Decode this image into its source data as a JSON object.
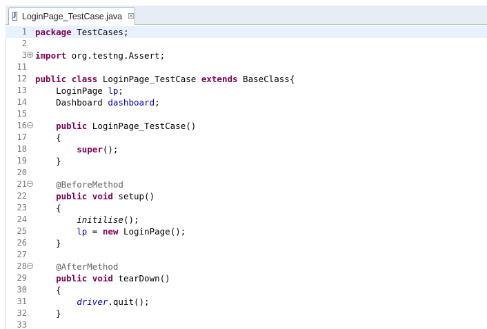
{
  "editor_tab": {
    "title": "LoginPage_TestCase.java",
    "icon": "java-file-icon",
    "close_glyph": "☒"
  },
  "code_lines": [
    {
      "n": "1",
      "fold": "",
      "current": true,
      "tokens": [
        {
          "t": "package",
          "s": "kw"
        },
        {
          "t": " TestCases;",
          "s": ""
        }
      ]
    },
    {
      "n": "2",
      "fold": "",
      "tokens": []
    },
    {
      "n": "3",
      "fold": "collapsed",
      "tokens": [
        {
          "t": "import",
          "s": "kw"
        },
        {
          "t": " org.testng.Assert;",
          "s": ""
        }
      ]
    },
    {
      "n": "11",
      "fold": "",
      "tokens": []
    },
    {
      "n": "12",
      "fold": "",
      "tokens": [
        {
          "t": "public",
          "s": "kw"
        },
        {
          "t": " ",
          "s": ""
        },
        {
          "t": "class",
          "s": "kw"
        },
        {
          "t": " LoginPage_TestCase ",
          "s": ""
        },
        {
          "t": "extends",
          "s": "kw"
        },
        {
          "t": " BaseClass{",
          "s": ""
        }
      ]
    },
    {
      "n": "13",
      "fold": "",
      "tokens": [
        {
          "t": "    LoginPage ",
          "s": ""
        },
        {
          "t": "lp",
          "s": "fld"
        },
        {
          "t": ";",
          "s": ""
        }
      ]
    },
    {
      "n": "14",
      "fold": "",
      "tokens": [
        {
          "t": "    Dashboard ",
          "s": ""
        },
        {
          "t": "dashboard",
          "s": "fld"
        },
        {
          "t": ";",
          "s": ""
        }
      ]
    },
    {
      "n": "15",
      "fold": "",
      "tokens": []
    },
    {
      "n": "16",
      "fold": "expanded",
      "tokens": [
        {
          "t": "    ",
          "s": ""
        },
        {
          "t": "public",
          "s": "kw"
        },
        {
          "t": " LoginPage_TestCase()",
          "s": ""
        }
      ]
    },
    {
      "n": "17",
      "fold": "",
      "tokens": [
        {
          "t": "    {",
          "s": ""
        }
      ]
    },
    {
      "n": "18",
      "fold": "",
      "tokens": [
        {
          "t": "        ",
          "s": ""
        },
        {
          "t": "super",
          "s": "kw"
        },
        {
          "t": "();",
          "s": ""
        }
      ]
    },
    {
      "n": "19",
      "fold": "",
      "tokens": [
        {
          "t": "    }",
          "s": ""
        }
      ]
    },
    {
      "n": "20",
      "fold": "",
      "tokens": []
    },
    {
      "n": "21",
      "fold": "expanded",
      "tokens": [
        {
          "t": "    ",
          "s": ""
        },
        {
          "t": "@BeforeMethod",
          "s": "ann"
        }
      ]
    },
    {
      "n": "22",
      "fold": "",
      "tokens": [
        {
          "t": "    ",
          "s": ""
        },
        {
          "t": "public",
          "s": "kw"
        },
        {
          "t": " ",
          "s": ""
        },
        {
          "t": "void",
          "s": "kw"
        },
        {
          "t": " setup()",
          "s": ""
        }
      ]
    },
    {
      "n": "23",
      "fold": "",
      "tokens": [
        {
          "t": "    {",
          "s": ""
        }
      ]
    },
    {
      "n": "24",
      "fold": "",
      "tokens": [
        {
          "t": "        ",
          "s": ""
        },
        {
          "t": "initilise",
          "s": "ital"
        },
        {
          "t": "();",
          "s": ""
        }
      ]
    },
    {
      "n": "25",
      "fold": "",
      "tokens": [
        {
          "t": "        ",
          "s": ""
        },
        {
          "t": "lp",
          "s": "fld"
        },
        {
          "t": " = ",
          "s": ""
        },
        {
          "t": "new",
          "s": "kw"
        },
        {
          "t": " LoginPage();",
          "s": ""
        }
      ]
    },
    {
      "n": "26",
      "fold": "",
      "tokens": [
        {
          "t": "    }",
          "s": ""
        }
      ]
    },
    {
      "n": "27",
      "fold": "",
      "tokens": []
    },
    {
      "n": "28",
      "fold": "expanded",
      "tokens": [
        {
          "t": "    ",
          "s": ""
        },
        {
          "t": "@AfterMethod",
          "s": "ann"
        }
      ]
    },
    {
      "n": "29",
      "fold": "",
      "tokens": [
        {
          "t": "    ",
          "s": ""
        },
        {
          "t": "public",
          "s": "kw"
        },
        {
          "t": " ",
          "s": ""
        },
        {
          "t": "void",
          "s": "kw"
        },
        {
          "t": " tearDown()",
          "s": ""
        }
      ]
    },
    {
      "n": "30",
      "fold": "",
      "tokens": [
        {
          "t": "    {",
          "s": ""
        }
      ]
    },
    {
      "n": "31",
      "fold": "",
      "tokens": [
        {
          "t": "        ",
          "s": ""
        },
        {
          "t": "driver",
          "s": "fld-ital"
        },
        {
          "t": ".quit();",
          "s": ""
        }
      ]
    },
    {
      "n": "32",
      "fold": "",
      "tokens": [
        {
          "t": "    }",
          "s": ""
        }
      ]
    },
    {
      "n": "33",
      "fold": "",
      "tokens": []
    }
  ],
  "colors": {
    "keyword": "#7f0055",
    "field": "#0000c0",
    "annotation": "#646464",
    "current_line": "#e8f2fe",
    "line_number": "#787878",
    "tab_bar": "#e7edf4"
  }
}
